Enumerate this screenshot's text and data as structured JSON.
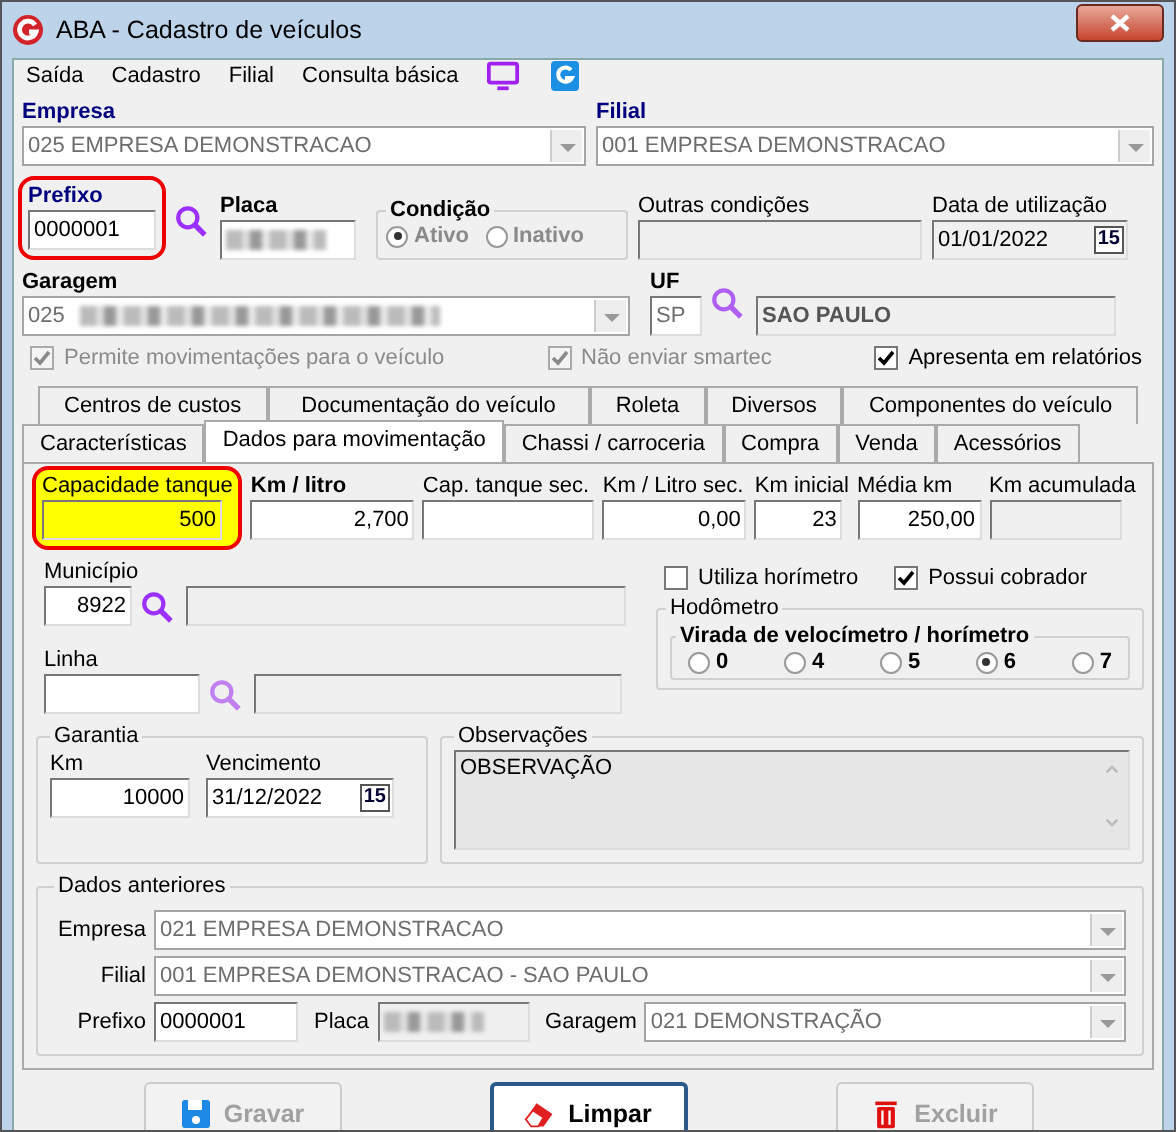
{
  "window": {
    "title": "ABA - Cadastro de veículos"
  },
  "menu": [
    {
      "label": "Saída"
    },
    {
      "label": "Cadastro"
    },
    {
      "label": "Filial"
    },
    {
      "label": "Consulta básica"
    }
  ],
  "empresa": {
    "label": "Empresa",
    "required": true,
    "value": "025 EMPRESA DEMONSTRACAO"
  },
  "filial": {
    "label": "Filial",
    "required": true,
    "value": "001 EMPRESA DEMONSTRACAO"
  },
  "prefixo": {
    "label": "Prefixo",
    "required": true,
    "value": "0000001",
    "highlighted": true
  },
  "placa": {
    "label": "Placa",
    "bold": true
  },
  "condicao": {
    "label": "Condição",
    "options": [
      {
        "label": "Ativo",
        "selected": true
      },
      {
        "label": "Inativo",
        "selected": false
      }
    ]
  },
  "outras_condicoes": {
    "label": "Outras condições"
  },
  "data_utilizacao": {
    "label": "Data de utilização",
    "value": "01/01/2022",
    "calendar_day": "15"
  },
  "garagem": {
    "label": "Garagem",
    "bold": true,
    "value": "025"
  },
  "uf": {
    "label": "UF",
    "bold": true,
    "value": "SP",
    "name": "SAO PAULO"
  },
  "checks": [
    {
      "label": "Permite movimentações para o veículo",
      "checked": true,
      "disabled": true
    },
    {
      "label": "Não enviar smartec",
      "checked": true,
      "disabled": true
    },
    {
      "label": "Apresenta em relatórios",
      "checked": true,
      "disabled": false
    }
  ],
  "tabs_row1": [
    {
      "label": "Centros de custos",
      "selected": false
    },
    {
      "label": "Documentação do veículo",
      "selected": false
    },
    {
      "label": "Roleta",
      "selected": false
    },
    {
      "label": "Diversos",
      "selected": false
    },
    {
      "label": "Componentes do veículo",
      "selected": false
    }
  ],
  "tabs_row2": [
    {
      "label": "Características",
      "selected": false
    },
    {
      "label": "Dados para movimentação",
      "selected": true
    },
    {
      "label": "Chassi / carroceria",
      "selected": false
    },
    {
      "label": "Compra",
      "selected": false
    },
    {
      "label": "Venda",
      "selected": false
    },
    {
      "label": "Acessórios",
      "selected": false
    }
  ],
  "movimentacao": [
    {
      "label": "Capacidade tanque",
      "bold": false,
      "value": "500",
      "highlighted": true,
      "disabled": false
    },
    {
      "label": "Km / litro",
      "bold": true,
      "value": "2,700",
      "highlighted": false,
      "disabled": false
    },
    {
      "label": "Cap. tanque sec.",
      "bold": false,
      "highlighted": false,
      "disabled": false
    },
    {
      "label": "Km / Litro sec.",
      "bold": false,
      "value": "0,00",
      "highlighted": false,
      "disabled": false
    },
    {
      "label": "Km inicial",
      "bold": false,
      "value": "23",
      "highlighted": false,
      "disabled": false
    },
    {
      "label": "Média km",
      "bold": false,
      "value": "250,00",
      "highlighted": false,
      "disabled": false
    },
    {
      "label": "Km acumulada",
      "bold": false,
      "highlighted": false,
      "disabled": true
    }
  ],
  "municipio": {
    "label": "Município",
    "value": "8922"
  },
  "linha": {
    "label": "Linha"
  },
  "utiliza_horimetro": {
    "label": "Utiliza horímetro",
    "checked": false
  },
  "possui_cobrador": {
    "label": "Possui cobrador",
    "checked": true
  },
  "hodometro": {
    "label": "Hodômetro",
    "group_label": "Virada de velocímetro / horímetro",
    "options": [
      {
        "label": "0",
        "selected": false
      },
      {
        "label": "4",
        "selected": false
      },
      {
        "label": "5",
        "selected": false
      },
      {
        "label": "6",
        "selected": true
      },
      {
        "label": "7",
        "selected": false
      }
    ]
  },
  "garantia": {
    "label": "Garantia",
    "km_label": "Km",
    "km": "10000",
    "vencimento_label": "Vencimento",
    "vencimento": "31/12/2022",
    "calendar_day": "15"
  },
  "observacoes": {
    "label": "Observações",
    "value": "OBSERVAÇÃO"
  },
  "dados_anteriores": {
    "label": "Dados anteriores",
    "empresa_label": "Empresa",
    "empresa": "021 EMPRESA DEMONSTRACAO",
    "filial_label": "Filial",
    "filial": "001 EMPRESA DEMONSTRACAO - SAO PAULO",
    "prefixo_label": "Prefixo",
    "prefixo": "0000001",
    "placa_label": "Placa",
    "garagem_label": "Garagem",
    "garagem": "021 DEMONSTRAÇÃO"
  },
  "buttons": [
    {
      "label": "Gravar",
      "kind": "save",
      "disabled": true
    },
    {
      "label": "Limpar",
      "kind": "clear",
      "disabled": false
    },
    {
      "label": "Excluir",
      "kind": "delete",
      "disabled": true
    }
  ]
}
